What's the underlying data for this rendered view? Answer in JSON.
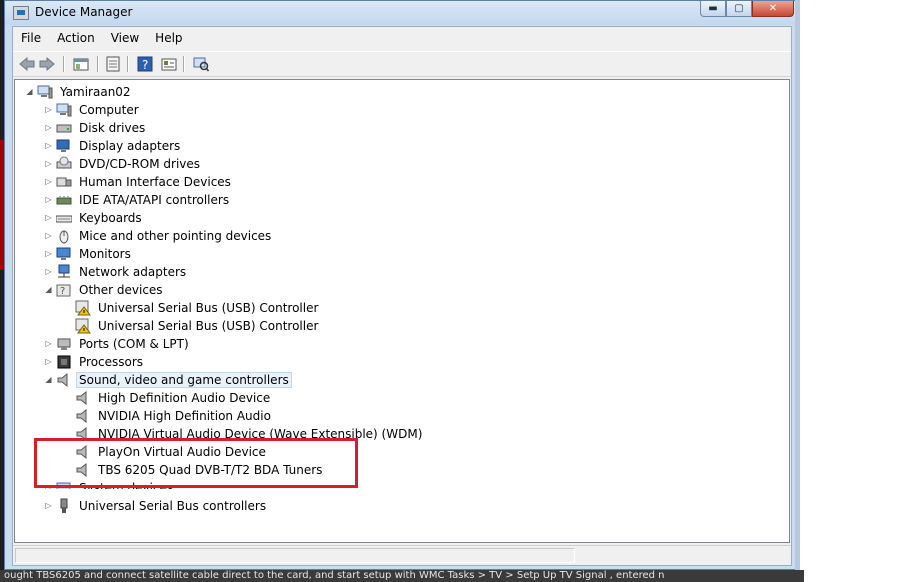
{
  "window": {
    "title": "Device Manager",
    "buttons": {
      "minimize": "▬",
      "maximize": "▢",
      "close": "✕"
    }
  },
  "menu": [
    "File",
    "Action",
    "View",
    "Help"
  ],
  "toolbar_icons": [
    "back-arrow-icon",
    "forward-arrow-icon",
    "console-tree-icon",
    "properties-icon",
    "help-icon",
    "update-driver-icon",
    "scan-hardware-icon"
  ],
  "tree": {
    "root": "Yamiraan02",
    "categories": [
      {
        "label": "Computer",
        "icon": "computer-icon",
        "expanded": false
      },
      {
        "label": "Disk drives",
        "icon": "disk-drive-icon",
        "expanded": false
      },
      {
        "label": "Display adapters",
        "icon": "display-adapter-icon",
        "expanded": false
      },
      {
        "label": "DVD/CD-ROM drives",
        "icon": "dvd-drive-icon",
        "expanded": false
      },
      {
        "label": "Human Interface Devices",
        "icon": "hid-icon",
        "expanded": false
      },
      {
        "label": "IDE ATA/ATAPI controllers",
        "icon": "ide-controller-icon",
        "expanded": false
      },
      {
        "label": "Keyboards",
        "icon": "keyboard-icon",
        "expanded": false
      },
      {
        "label": "Mice and other pointing devices",
        "icon": "mouse-icon",
        "expanded": false
      },
      {
        "label": "Monitors",
        "icon": "monitor-icon",
        "expanded": false
      },
      {
        "label": "Network adapters",
        "icon": "network-adapter-icon",
        "expanded": false
      },
      {
        "label": "Other devices",
        "icon": "unknown-device-icon",
        "expanded": true,
        "children": [
          "Universal Serial Bus (USB) Controller",
          "Universal Serial Bus (USB) Controller"
        ]
      },
      {
        "label": "Ports (COM & LPT)",
        "icon": "port-icon",
        "expanded": false
      },
      {
        "label": "Processors",
        "icon": "processor-icon",
        "expanded": false
      },
      {
        "label": "Sound, video and game controllers",
        "icon": "speaker-icon",
        "expanded": true,
        "children": [
          "High Definition Audio Device",
          "NVIDIA High Definition Audio",
          "NVIDIA Virtual Audio Device (Wave Extensible) (WDM)",
          "PlayOn Virtual Audio Device",
          "TBS 6205 Quad DVB-T/T2 BDA Tuners"
        ]
      },
      {
        "label": "System devices",
        "icon": "system-device-icon",
        "expanded": false
      },
      {
        "label": "Universal Serial Bus controllers",
        "icon": "usb-icon",
        "expanded": false
      }
    ]
  },
  "background_text": "ought TBS6205 and connect satellite cable direct to the card, and start setup with WMC  Tasks > TV > Setp Up TV Signal , entered n",
  "colors": {
    "highlight_box": "#d4202a",
    "selection": "#e9f1f9"
  }
}
